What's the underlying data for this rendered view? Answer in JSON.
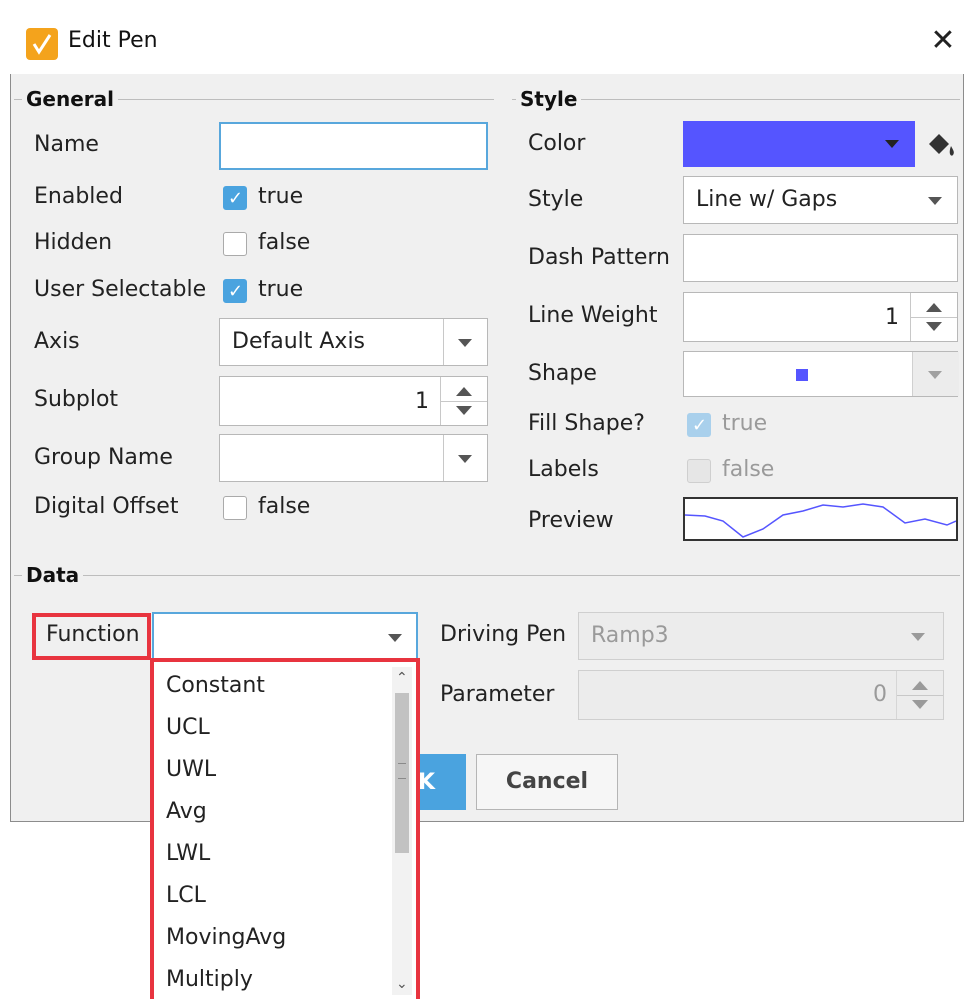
{
  "window": {
    "title": "Edit Pen"
  },
  "general": {
    "section_title": "General",
    "name": {
      "label": "Name",
      "value": ""
    },
    "enabled": {
      "label": "Enabled",
      "checked": true,
      "text": "true"
    },
    "hidden": {
      "label": "Hidden",
      "checked": false,
      "text": "false"
    },
    "user_selectable": {
      "label": "User Selectable",
      "checked": true,
      "text": "true"
    },
    "axis": {
      "label": "Axis",
      "value": "Default Axis"
    },
    "subplot": {
      "label": "Subplot",
      "value": "1"
    },
    "group_name": {
      "label": "Group Name",
      "value": ""
    },
    "digital_offset": {
      "label": "Digital Offset",
      "checked": false,
      "text": "false"
    }
  },
  "style": {
    "section_title": "Style",
    "color": {
      "label": "Color",
      "swatch": "#5555ff"
    },
    "style": {
      "label": "Style",
      "value": "Line w/ Gaps"
    },
    "dash_pattern": {
      "label": "Dash Pattern",
      "value": ""
    },
    "line_weight": {
      "label": "Line Weight",
      "value": "1"
    },
    "shape": {
      "label": "Shape"
    },
    "fill_shape": {
      "label": "Fill Shape?",
      "checked": true,
      "text": "true"
    },
    "labels": {
      "label": "Labels",
      "checked": false,
      "text": "false"
    },
    "preview": {
      "label": "Preview"
    }
  },
  "data": {
    "section_title": "Data",
    "function": {
      "label": "Function",
      "value": ""
    },
    "driving_pen": {
      "label": "Driving Pen",
      "value": "Ramp3"
    },
    "parameter": {
      "label": "Parameter",
      "value": "0"
    },
    "function_options": [
      "Constant",
      "UCL",
      "UWL",
      "Avg",
      "LWL",
      "LCL",
      "MovingAvg",
      "Multiply"
    ]
  },
  "buttons": {
    "ok_fragment": "K",
    "cancel": "Cancel"
  },
  "colors": {
    "accent": "#4aa3df",
    "highlight": "#e8343f",
    "line": "#5555ff"
  }
}
